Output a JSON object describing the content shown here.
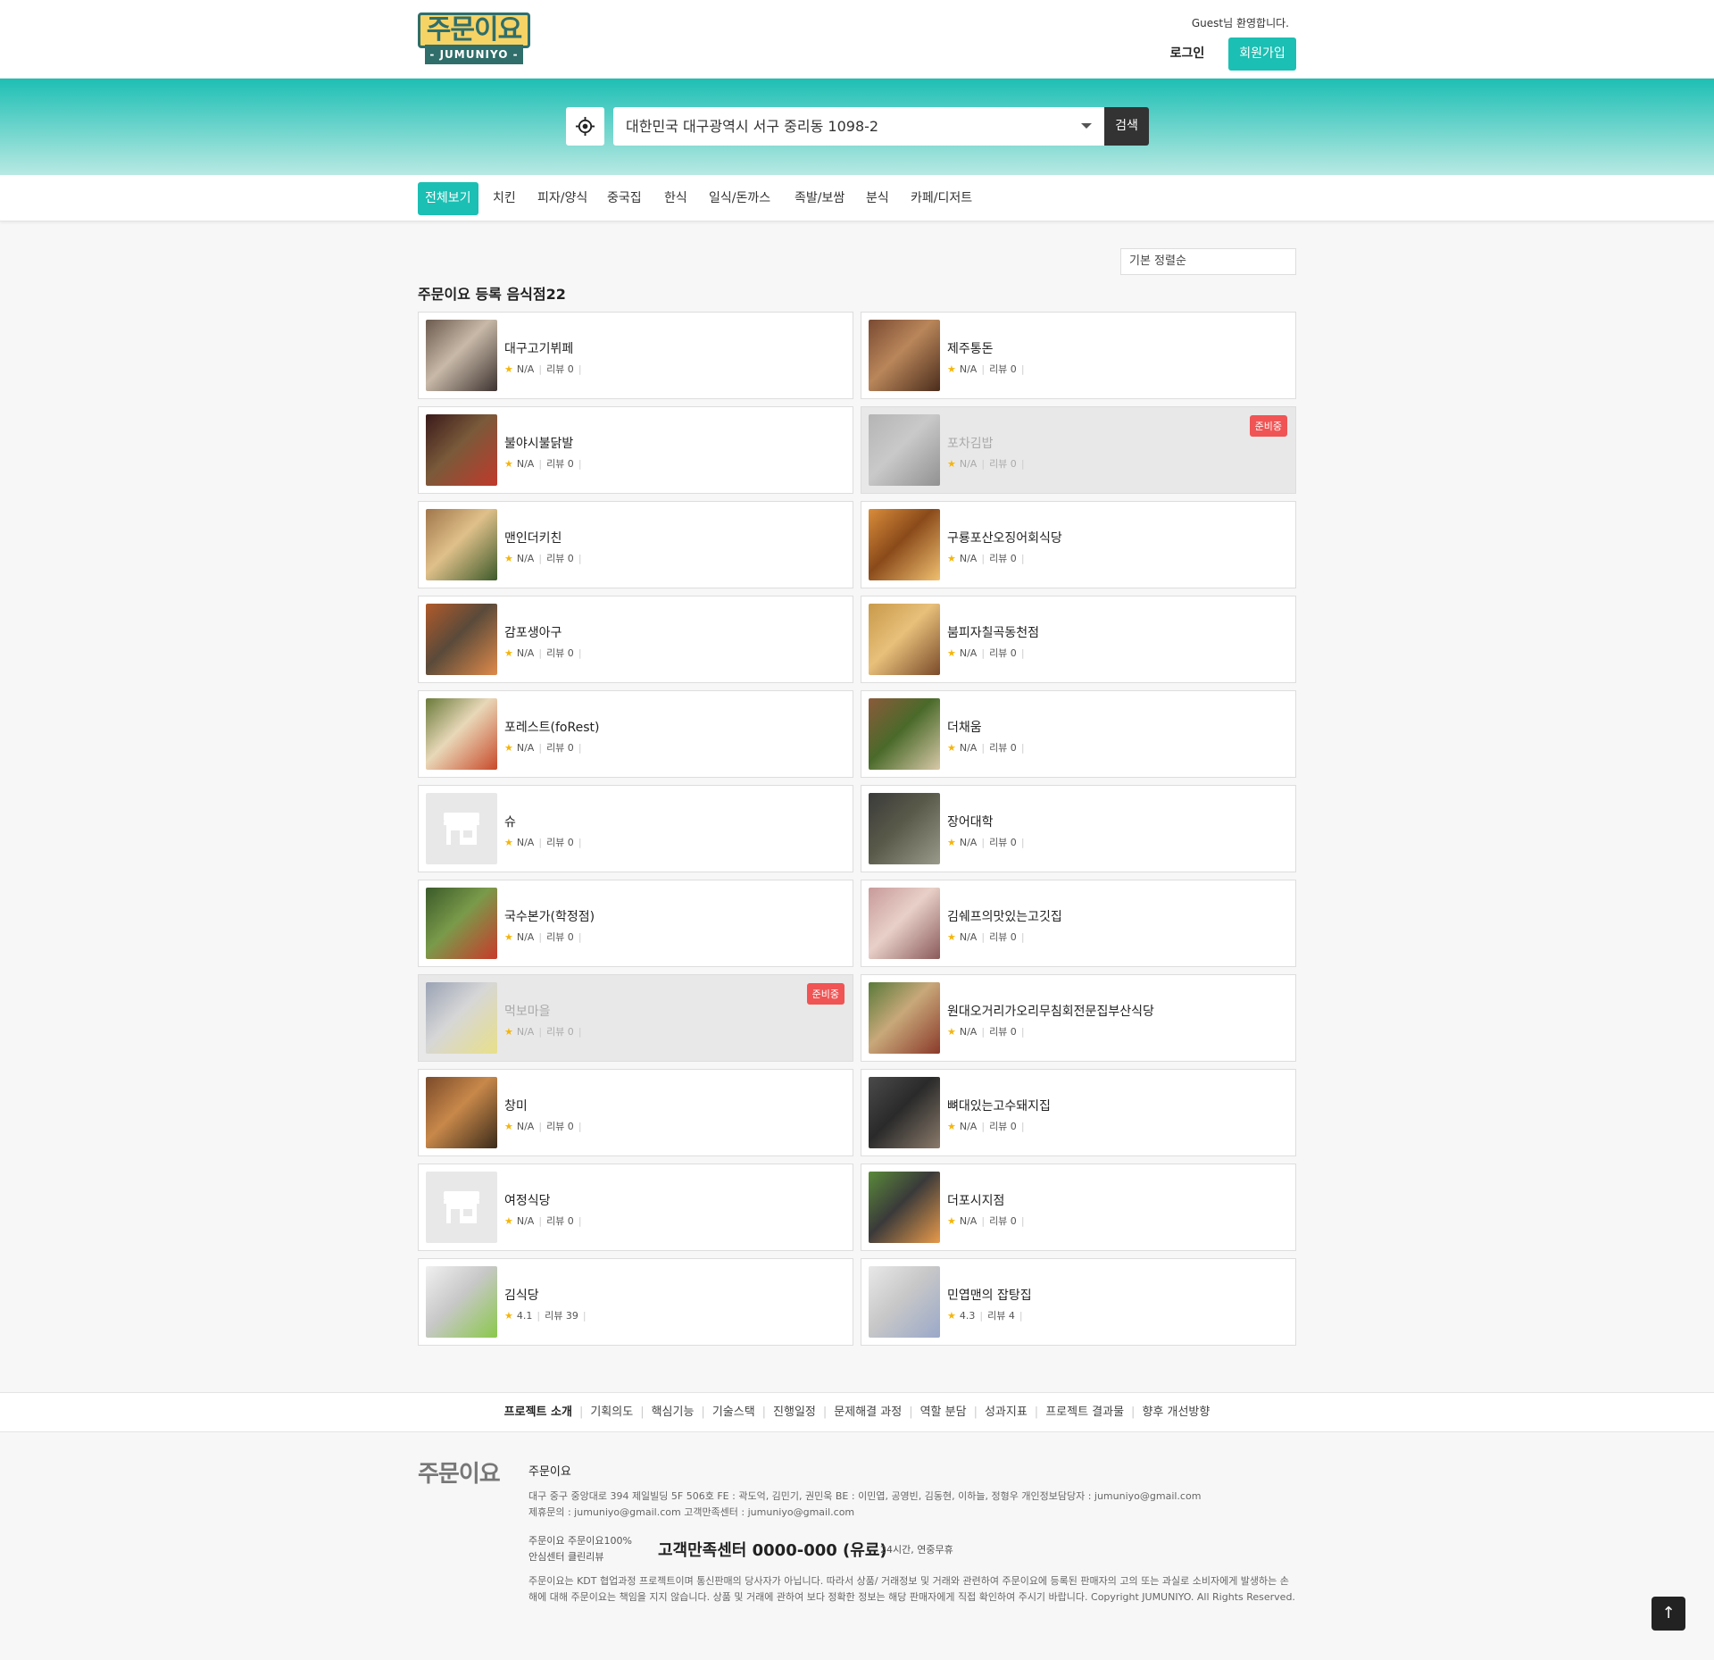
{
  "header": {
    "logo_text": "주문이요",
    "logo_sub": "- JUMUNIYO -",
    "welcome": "Guest님 환영합니다.",
    "login_label": "로그인",
    "signup_label": "회원가입"
  },
  "search": {
    "locate_icon": "crosshair-icon",
    "address": "대한민국 대구광역시 서구 중리동 1098-2",
    "button_label": "검색"
  },
  "categories": [
    "전체보기",
    "치킨",
    "피자/양식",
    "중국집",
    "한식",
    "일식/돈까스",
    "족발/보쌈",
    "분식",
    "카페/디저트"
  ],
  "active_category": "전체보기",
  "sort": {
    "selected": "기본 정렬순"
  },
  "list_title": "주문이요 등록 음식점22",
  "restaurants": [
    {
      "name": "대구고기뷔페",
      "rating": "N/A",
      "review_label": "리뷰 0",
      "status": ""
    },
    {
      "name": "제주통돈",
      "rating": "N/A",
      "review_label": "리뷰 0",
      "status": ""
    },
    {
      "name": "불야시불닭발",
      "rating": "N/A",
      "review_label": "리뷰 0",
      "status": ""
    },
    {
      "name": "포차김밥",
      "rating": "N/A",
      "review_label": "리뷰 0",
      "status": "준비중"
    },
    {
      "name": "맨인더키친",
      "rating": "N/A",
      "review_label": "리뷰 0",
      "status": ""
    },
    {
      "name": "구룡포산오징어회식당",
      "rating": "N/A",
      "review_label": "리뷰 0",
      "status": ""
    },
    {
      "name": "감포생아구",
      "rating": "N/A",
      "review_label": "리뷰 0",
      "status": ""
    },
    {
      "name": "붐피자칠곡동천점",
      "rating": "N/A",
      "review_label": "리뷰 0",
      "status": ""
    },
    {
      "name": "포레스트(foRest)",
      "rating": "N/A",
      "review_label": "리뷰 0",
      "status": ""
    },
    {
      "name": "더채움",
      "rating": "N/A",
      "review_label": "리뷰 0",
      "status": ""
    },
    {
      "name": "슈",
      "rating": "N/A",
      "review_label": "리뷰 0",
      "status": ""
    },
    {
      "name": "장어대학",
      "rating": "N/A",
      "review_label": "리뷰 0",
      "status": ""
    },
    {
      "name": "국수본가(학정점)",
      "rating": "N/A",
      "review_label": "리뷰 0",
      "status": ""
    },
    {
      "name": "김쉐프의맛있는고깃집",
      "rating": "N/A",
      "review_label": "리뷰 0",
      "status": ""
    },
    {
      "name": "먹보마을",
      "rating": "N/A",
      "review_label": "리뷰 0",
      "status": "준비중"
    },
    {
      "name": "원대오거리가오리무침회전문집부산식당",
      "rating": "N/A",
      "review_label": "리뷰 0",
      "status": ""
    },
    {
      "name": "창미",
      "rating": "N/A",
      "review_label": "리뷰 0",
      "status": ""
    },
    {
      "name": "뼈대있는고수돼지집",
      "rating": "N/A",
      "review_label": "리뷰 0",
      "status": ""
    },
    {
      "name": "여정식당",
      "rating": "N/A",
      "review_label": "리뷰 0",
      "status": ""
    },
    {
      "name": "더포시지점",
      "rating": "N/A",
      "review_label": "리뷰 0",
      "status": ""
    },
    {
      "name": "김식당",
      "rating": "4.1",
      "review_label": "리뷰 39",
      "status": ""
    },
    {
      "name": "민엽맨의 잡탕집",
      "rating": "4.3",
      "review_label": "리뷰 4",
      "status": ""
    }
  ],
  "footer_nav": [
    "프로젝트 소개",
    "기획의도",
    "핵심기능",
    "기술스택",
    "진행일정",
    "문제해결 과정",
    "역할 분담",
    "성과지표",
    "프로젝트 결과물",
    "향후 개선방향"
  ],
  "footer": {
    "logo": "주문이요",
    "company": "주문이요",
    "address_line": "대구 중구 중앙대로 394 제일빌딩 5F 506호    FE : 곽도억, 김민기, 권민욱    BE : 이민엽, 공영빈, 김동현, 이하늘, 정형우    개인정보담당자 : jumuniyo@gmail.com",
    "contact_line": "제휴문의 : jumuniyo@gmail.com    고객만족센터 : jumuniyo@gmail.com",
    "service_line1": "주문이요    주문이요100%",
    "service_line2": "안심센터    클린리뷰",
    "phone": "고객만족센터 0000-000 (유료)",
    "hours": "24시간, 연중무휴",
    "disclaimer": "주문이요는 KDT 협업과정 프로젝트이며 통신판매의 당사자가 아닙니다. 따라서 상품/ 거래정보 및 거래와 관련하여 주문이요에 등록된 판매자의 고의 또는 과실로 소비자에게 발생하는 손해에 대해 주문이요는 책임을 지지 않습니다. 상품 및 거래에 관하여 보다 정확한 정보는 해당 판매자에게 직접 확인하여 주시기 바랍니다. Copyright JUMUNIYO. All Rights Reserved.",
    "top_button": "↑"
  },
  "colors": {
    "accent": "#1bbfb3",
    "badge": "#f05454",
    "star": "#f5b50a"
  }
}
